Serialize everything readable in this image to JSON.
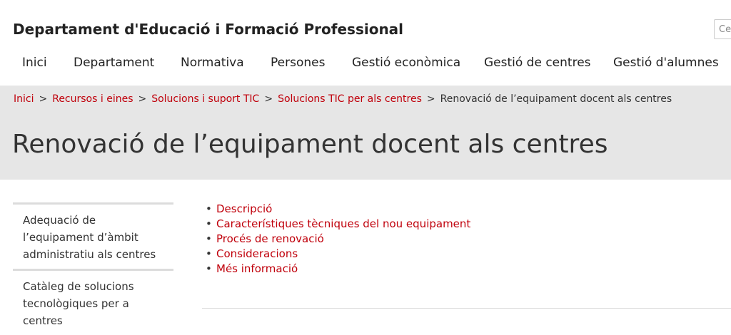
{
  "header": {
    "site_title": "Departament d'Educació i Formació Professional",
    "search_placeholder": "Ce"
  },
  "nav": {
    "items": [
      "Inici",
      "Departament",
      "Normativa",
      "Persones",
      "Gestió econòmica",
      "Gestió de centres",
      "Gestió d'alumnes"
    ]
  },
  "breadcrumb": {
    "links": [
      "Inici",
      "Recursos i eines",
      "Solucions i suport TIC",
      "Solucions TIC per als centres"
    ],
    "separator": ">",
    "current": "Renovació de l’equipament docent als centres"
  },
  "page": {
    "title": "Renovació de l’equipament docent als centres"
  },
  "sidebar": {
    "items": [
      "Adequació de l’equipament d’àmbit administratiu als centres",
      "Catàleg de solucions tecnològiques per a centres"
    ]
  },
  "toc": {
    "bullet": "•",
    "items": [
      "Descripció",
      "Característiques tècniques del nou equipament",
      "Procés de renovació",
      "Consideracions",
      "Més informació"
    ]
  },
  "colors": {
    "link": "#c0000b",
    "band": "#e6e6e6",
    "text": "#333333"
  }
}
